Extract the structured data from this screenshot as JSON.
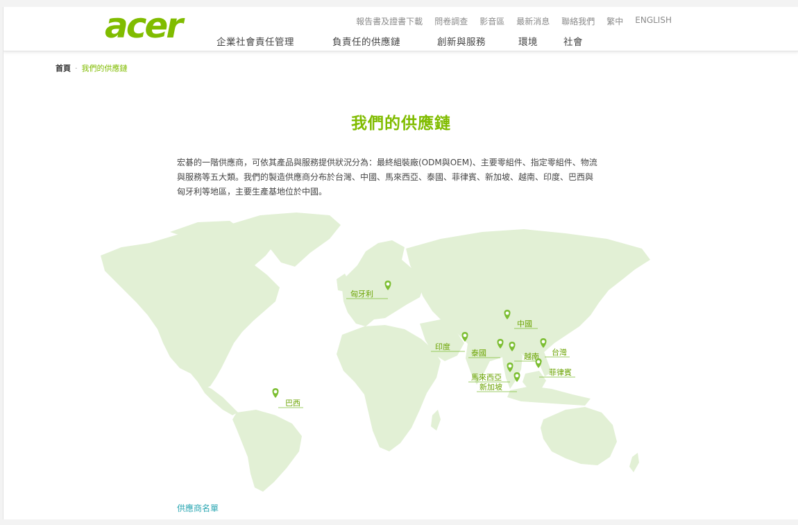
{
  "brand": {
    "logo_text": "acer",
    "accent": "#80bc00",
    "map_fill": "#e2f0d5",
    "pin_color": "#7cbe32"
  },
  "util_nav": [
    {
      "label": "報告書及證書下載"
    },
    {
      "label": "問卷調查"
    },
    {
      "label": "影音區"
    },
    {
      "label": "最新消息"
    },
    {
      "label": "聯絡我們"
    },
    {
      "label": "繁中"
    },
    {
      "label": "ENGLISH"
    }
  ],
  "main_nav": [
    {
      "label": "企業社會責任管理"
    },
    {
      "label": "負責任的供應鏈"
    },
    {
      "label": "創新與服務"
    },
    {
      "label": "環境"
    },
    {
      "label": "社會"
    }
  ],
  "breadcrumb": {
    "home": "首頁",
    "separator": "·",
    "current": "我們的供應鏈"
  },
  "page": {
    "title": "我們的供應鏈",
    "intro_lines": [
      "宏碁的一階供應商，可依其產品與服務提供狀況分為：最終組裝廠(ODM與OEM)、主要零組件、指定零組件、物流",
      "與服務等五大類。我們的製造供應商分布於台灣、中國、馬來西亞、泰國、菲律賓、新加坡、越南、印度、巴西與",
      "匈牙利等地區，主要生產基地位於中國。"
    ],
    "supplier_list_link": "供應商名單"
  },
  "map": {
    "locations": [
      {
        "name": "匈牙利"
      },
      {
        "name": "中國"
      },
      {
        "name": "印度"
      },
      {
        "name": "泰國"
      },
      {
        "name": "越南"
      },
      {
        "name": "台灣"
      },
      {
        "name": "菲律賓"
      },
      {
        "name": "馬來西亞"
      },
      {
        "name": "新加坡"
      },
      {
        "name": "巴西"
      }
    ]
  }
}
